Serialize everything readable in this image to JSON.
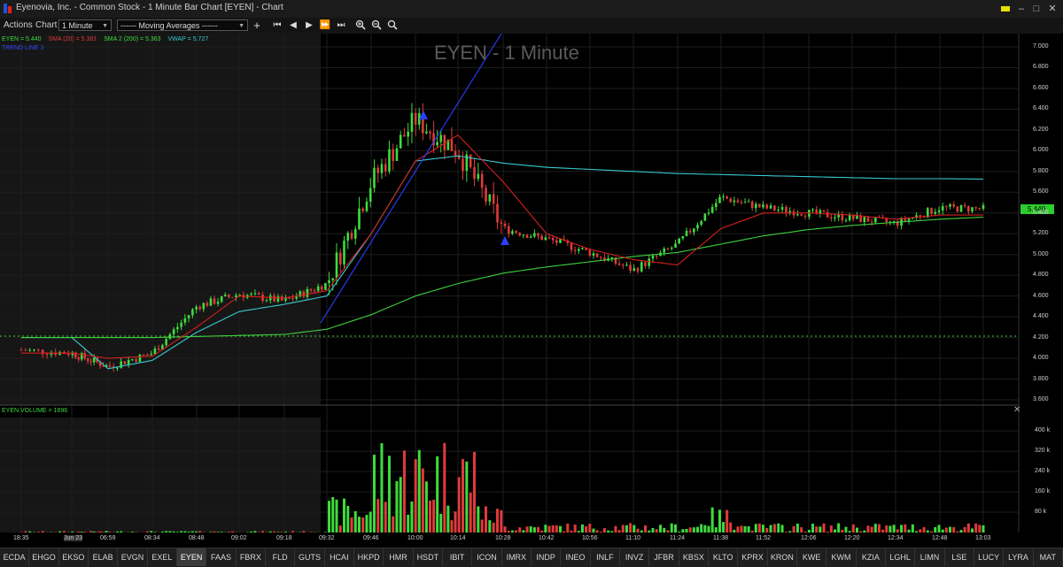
{
  "window": {
    "title": "Eyenovia, Inc. - Common Stock - 1 Minute Bar Chart [EYEN] - Chart"
  },
  "toolbar": {
    "actions_label": "Actions",
    "chart_label": "Chart",
    "interval_value": "1 Minute",
    "studies_value": "------  Moving Averages  ------",
    "add_label": "+",
    "nav_buttons": [
      "⏮",
      "◀",
      "▶",
      "⏭",
      "⏭"
    ]
  },
  "chart": {
    "title": "EYEN - 1 Minute",
    "legend": {
      "price": "EYEN = 5.440",
      "sma20": "SMA (20) = 5.381",
      "sma200": "SMA 2 (200) = 5.363",
      "vwap": "VWAP = 5.727",
      "trendline": "TREND LINE 3"
    },
    "current_price_tag": "5.440",
    "volume_legend": "EYEN.VOLUME = 1696",
    "colors": {
      "up": "#3ddc3d",
      "down": "#e03a3a",
      "sma20": "#d42020",
      "sma200": "#3ecf3e",
      "vwap": "#38c8d0",
      "trend": "#2a3fff",
      "dotted": "#3ecf3e"
    }
  },
  "chart_data": {
    "type": "line",
    "title": "EYEN - 1 Minute",
    "xlabel": "",
    "ylabel": "",
    "ylim": [
      3.6,
      7.0
    ],
    "x": [
      "18:35",
      "Jun 23",
      "06:59",
      "08:34",
      "08:48",
      "09:02",
      "09:18",
      "09:32",
      "09:46",
      "10:00",
      "10:14",
      "10:28",
      "10:42",
      "10:56",
      "11:10",
      "11:24",
      "11:38",
      "11:52",
      "12:06",
      "12:20",
      "12:34",
      "12:48",
      "13:03"
    ],
    "series": [
      {
        "name": "EYEN",
        "values": [
          4.08,
          4.05,
          3.92,
          4.05,
          4.5,
          4.62,
          4.55,
          4.72,
          5.7,
          6.3,
          6.0,
          5.25,
          5.15,
          5.02,
          4.85,
          5.1,
          5.55,
          5.45,
          5.4,
          5.35,
          5.3,
          5.45,
          5.44
        ]
      },
      {
        "name": "SMA (20)",
        "values": [
          4.05,
          4.05,
          4.0,
          4.02,
          4.3,
          4.6,
          4.58,
          4.65,
          5.2,
          5.9,
          6.15,
          5.7,
          5.2,
          5.05,
          4.95,
          4.9,
          5.25,
          5.4,
          5.4,
          5.38,
          5.34,
          5.38,
          5.38
        ]
      },
      {
        "name": "SMA 2 (200)",
        "values": [
          4.2,
          4.2,
          4.2,
          4.2,
          4.21,
          4.22,
          4.23,
          4.28,
          4.42,
          4.6,
          4.72,
          4.82,
          4.88,
          4.93,
          4.98,
          5.02,
          5.1,
          5.18,
          5.24,
          5.28,
          5.31,
          5.34,
          5.36
        ]
      },
      {
        "name": "VWAP",
        "values": [
          4.2,
          4.2,
          3.9,
          3.98,
          4.25,
          4.45,
          4.52,
          4.6,
          5.2,
          5.9,
          5.95,
          5.88,
          5.84,
          5.82,
          5.8,
          5.78,
          5.77,
          5.76,
          5.75,
          5.74,
          5.73,
          5.73,
          5.727
        ]
      }
    ],
    "volume": {
      "name": "EYEN.VOLUME",
      "ylim": [
        0,
        460000
      ],
      "ticks": [
        "400 k",
        "320 k",
        "240 k",
        "160 k",
        "80 k"
      ]
    },
    "yticks": [
      "7.000",
      "6.800",
      "6.600",
      "6.400",
      "6.200",
      "6.000",
      "5.800",
      "5.600",
      "5.400",
      "5.200",
      "5.000",
      "4.800",
      "4.600",
      "4.400",
      "4.200",
      "4.000",
      "3.800",
      "3.600"
    ]
  },
  "tabs": [
    "ECDA",
    "EHGO",
    "EKSO",
    "ELAB",
    "EVGN",
    "EXEL",
    "EYEN",
    "FAAS",
    "FBRX",
    "FLD",
    "GUTS",
    "HCAI",
    "HKPD",
    "HMR",
    "HSDT",
    "IBIT",
    "ICON",
    "IMRX",
    "INDP",
    "INEO",
    "INLF",
    "INVZ",
    "JFBR",
    "KBSX",
    "KLTO",
    "KPRX",
    "KRON",
    "KWE",
    "KWM",
    "KZIA",
    "LGHL",
    "LIMN",
    "LSE",
    "LUCY",
    "LYRA",
    "MAT"
  ],
  "active_tab": "EYEN"
}
